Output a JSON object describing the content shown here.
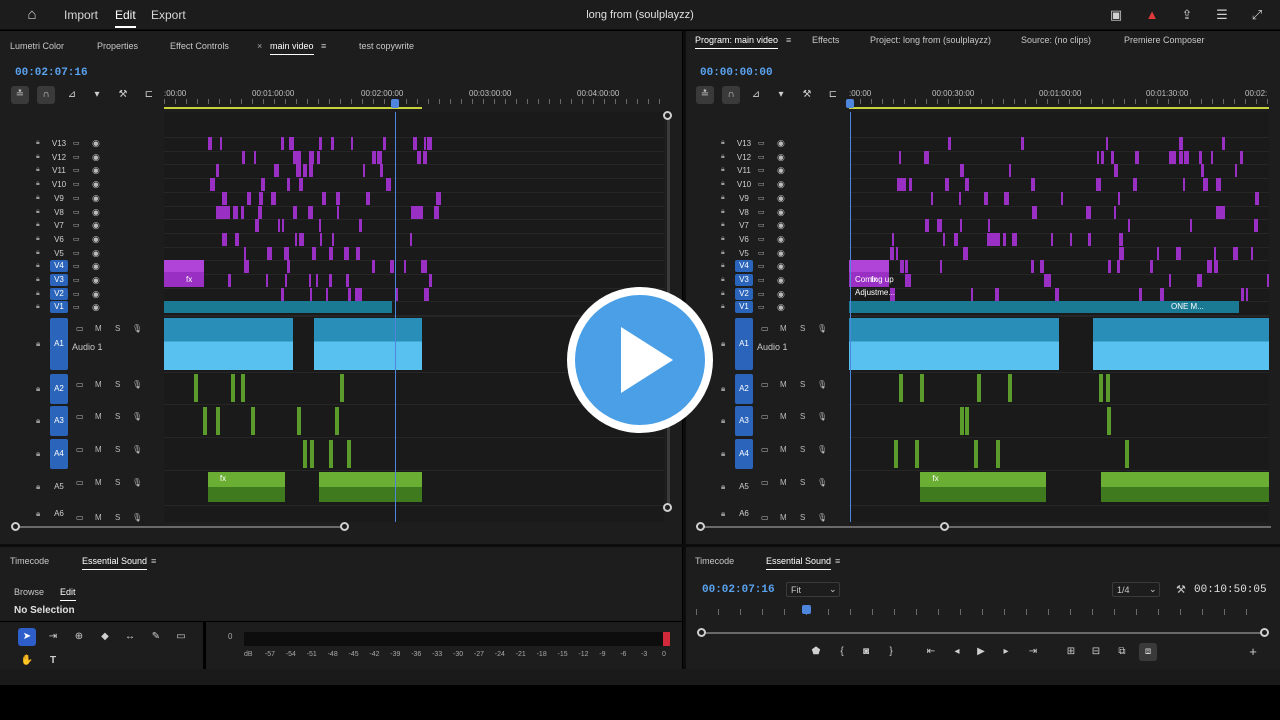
{
  "topbar": {
    "menus": [
      "Import",
      "Edit",
      "Export"
    ],
    "active_menu": "Edit",
    "project_title": "long from (soulplayzz)",
    "icons": [
      "home-icon",
      "captions-icon",
      "alert-icon",
      "share-icon",
      "menu-icon",
      "fullscreen-icon"
    ]
  },
  "left_panel": {
    "tabs": [
      "Lumetri Color",
      "Properties",
      "Effect Controls",
      "main video",
      "test copywrite"
    ],
    "active_tab": "main video",
    "timecode": "00:02:07:16",
    "ruler_labels": [
      ":00:00",
      "00:01:00:00",
      "00:02:00:00",
      "00:03:00:00",
      "00:04:00:00"
    ]
  },
  "right_panel": {
    "tabs": [
      "Program: main video",
      "Effects",
      "Project: long from (soulplayzz)",
      "Source: (no clips)",
      "Premiere Composer"
    ],
    "active_tab": "Program: main video",
    "timecode": "00:00:00:00",
    "ruler_labels": [
      ":00:00",
      "00:00:30:00",
      "00:01:00:00",
      "00:01:30:00",
      "00:02:"
    ],
    "clip_labels": [
      "Coming up",
      "Adjustme...",
      "ONE M..."
    ]
  },
  "video_tracks": [
    "V13",
    "V12",
    "V11",
    "V10",
    "V9",
    "V8",
    "V7",
    "V6",
    "V5",
    "V4",
    "V3",
    "V2",
    "V1"
  ],
  "audio_tracks": [
    "A1",
    "A2",
    "A3",
    "A4",
    "A5",
    "A6"
  ],
  "audio_track_name": "Audio 1",
  "track_buttons": {
    "mute": "M",
    "solo": "S"
  },
  "bottom_left": {
    "tabs": [
      "Timecode",
      "Essential Sound"
    ],
    "active_tab": "Essential Sound",
    "subtabs": [
      "Browse",
      "Edit"
    ],
    "active_subtab": "Edit",
    "selection": "No Selection"
  },
  "meter_labels": [
    "dB",
    "-57",
    "-54",
    "-51",
    "-48",
    "-45",
    "-42",
    "-39",
    "-36",
    "-33",
    "-30",
    "-27",
    "-24",
    "-21",
    "-18",
    "-15",
    "-12",
    "-9",
    "-6",
    "-3",
    "0"
  ],
  "meter_zero": "0",
  "bottom_right": {
    "tabs": [
      "Timecode",
      "Essential Sound"
    ],
    "active_tab": "Essential Sound",
    "timecode": "00:02:07:16",
    "fit": "Fit",
    "resolution": "1/4",
    "duration": "00:10:50:05"
  },
  "clip_badge": "fx",
  "colors": {
    "timecode": "#5aa3f0",
    "track_target": "#2b65bb",
    "video_clip": "#9a2fc4",
    "audio_clip": "#2a8fb8",
    "music_clip": "#5a9b2c",
    "play_button": "#4b9fe6"
  }
}
